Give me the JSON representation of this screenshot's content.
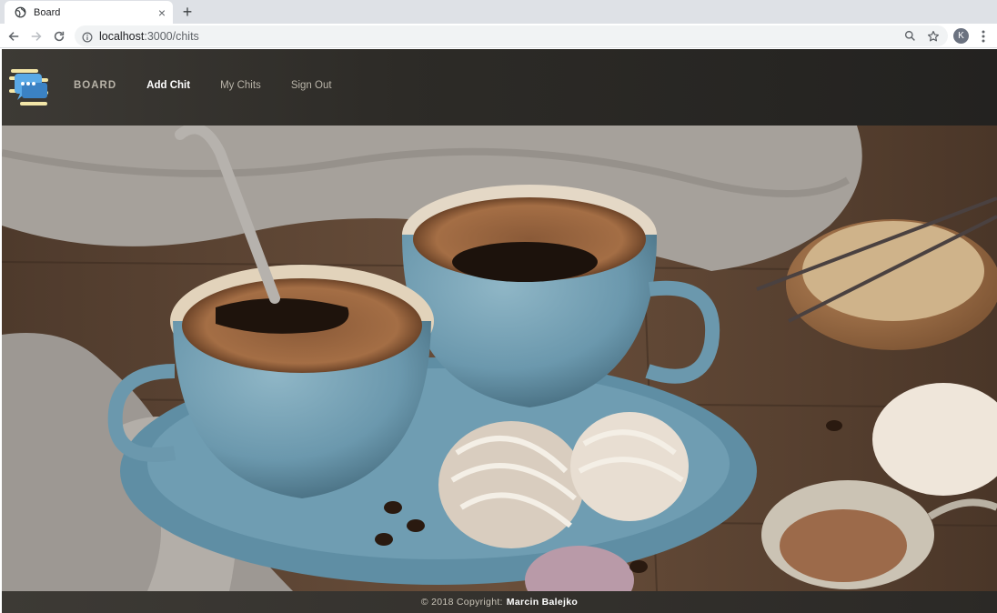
{
  "browser": {
    "tab_title": "Board",
    "url_host": "localhost",
    "url_path": ":3000/chits",
    "profile_initial": "K",
    "icons": [
      "globe-icon",
      "close-icon",
      "plus-icon",
      "back-icon",
      "forward-icon",
      "reload-icon",
      "info-icon",
      "zoom-icon",
      "star-icon",
      "kebab-menu-icon"
    ]
  },
  "nav": {
    "brand": "BOARD",
    "add_chit": "Add Chit",
    "my_chits": "My Chits",
    "sign_out": "Sign Out",
    "active": "Add Chit"
  },
  "footer": {
    "copyright": "© 2018 Copyright:",
    "author": "Marcin Balejko"
  },
  "colors": {
    "header_bg": "#2d2b27",
    "nav_text": "#b8b3a8",
    "nav_active": "#ffffff"
  }
}
